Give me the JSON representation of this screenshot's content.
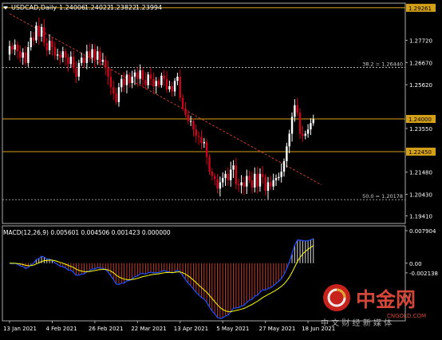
{
  "chart_data": [
    {
      "type": "candlestick",
      "header": {
        "symbol_timeframe": "USDCAD,Daily",
        "ohlc": [
          "1.24006",
          "1.24022",
          "1.23822",
          "1.23994"
        ]
      },
      "y_ticks": [
        "1.29261",
        "1.27720",
        "1.26670",
        "1.25620",
        "1.24000",
        "1.23550",
        "1.22450",
        "1.21480",
        "1.20430",
        "1.19410"
      ],
      "ylim": [
        1.1905,
        1.2948
      ],
      "horizontal_lines": [
        {
          "value": 1.29261,
          "label": "1.29261",
          "style": "solid",
          "color": "#d4a017"
        },
        {
          "value": 1.24,
          "label": "1.24000",
          "style": "solid",
          "color": "#d4a017"
        },
        {
          "value": 1.2245,
          "label": "1.22450",
          "style": "solid",
          "color": "#d4a017"
        },
        {
          "value": 1.2644,
          "label": "38.2 = 1.26440",
          "style": "dotted",
          "color": "#cccccc"
        },
        {
          "value": 1.20178,
          "label": "50.0 = 1.20178",
          "style": "dotted",
          "color": "#cccccc"
        }
      ],
      "trendline": {
        "from": {
          "bar": 0,
          "value": 1.2898
        },
        "to": {
          "bar": 117,
          "value": 1.2088
        },
        "style": "dashed",
        "color": "#c0392b"
      },
      "x_ticks": [
        {
          "bar": 0,
          "label": "13 Jan 2021"
        },
        {
          "bar": 16,
          "label": "4 Feb 2021"
        },
        {
          "bar": 32,
          "label": "26 Feb 2021"
        },
        {
          "bar": 48,
          "label": "22 Mar 2021"
        },
        {
          "bar": 64,
          "label": "13 Apr 2021"
        },
        {
          "bar": 80,
          "label": "5 May 2021"
        },
        {
          "bar": 96,
          "label": "27 May 2021"
        },
        {
          "bar": 112,
          "label": "18 Jun 2021"
        }
      ],
      "closes": [
        1.2745,
        1.2728,
        1.2752,
        1.272,
        1.269,
        1.2715,
        1.2665,
        1.274,
        1.2785,
        1.2772,
        1.2842,
        1.279,
        1.2835,
        1.276,
        1.2725,
        1.277,
        1.274,
        1.27,
        1.2705,
        1.269,
        1.272,
        1.269,
        1.266,
        1.2695,
        1.264,
        1.26,
        1.2665,
        1.269,
        1.2665,
        1.272,
        1.269,
        1.273,
        1.268,
        1.272,
        1.267,
        1.268,
        1.264,
        1.26,
        1.255,
        1.252,
        1.248,
        1.255,
        1.259,
        1.256,
        1.261,
        1.257,
        1.26,
        1.262,
        1.259,
        1.263,
        1.2585,
        1.256,
        1.261,
        1.259,
        1.2555,
        1.258,
        1.256,
        1.2605,
        1.259,
        1.254,
        1.2555,
        1.253,
        1.258,
        1.26,
        1.25,
        1.245,
        1.242,
        1.239,
        1.239,
        1.235,
        1.232,
        1.2315,
        1.2285,
        1.229,
        1.222,
        1.215,
        1.213,
        1.2115,
        1.207,
        1.21,
        1.212,
        1.214,
        1.211,
        1.216,
        1.218,
        1.209,
        1.2085,
        1.21,
        1.208,
        1.213,
        1.211,
        1.2075,
        1.214,
        1.208,
        1.214,
        1.2125,
        1.206,
        1.21,
        1.208,
        1.211,
        1.212,
        1.2125,
        1.215,
        1.22,
        1.227,
        1.233,
        1.241,
        1.2465,
        1.243,
        1.233,
        1.232,
        1.233,
        1.235,
        1.238,
        1.2399
      ],
      "macd": {
        "label": "MACD(12,26,9) 0.005601 0.004506 0.001423 0.000000",
        "y_ticks": [
          "0.007904",
          "0.00",
          "-0.002138"
        ],
        "ylim": [
          -0.0124,
          0.0079
        ],
        "zero_line": 0.0,
        "histogram_color_positive": "#d9d9d9",
        "histogram_color_negative": "#c0392b",
        "signal_color": "#ffff00",
        "macd_line_color": "#1f4fff"
      }
    }
  ],
  "watermark": {
    "brand": "中金网",
    "domain": "CNGOLD.COM",
    "tagline": "中 文 财 经 新 媒 体"
  }
}
